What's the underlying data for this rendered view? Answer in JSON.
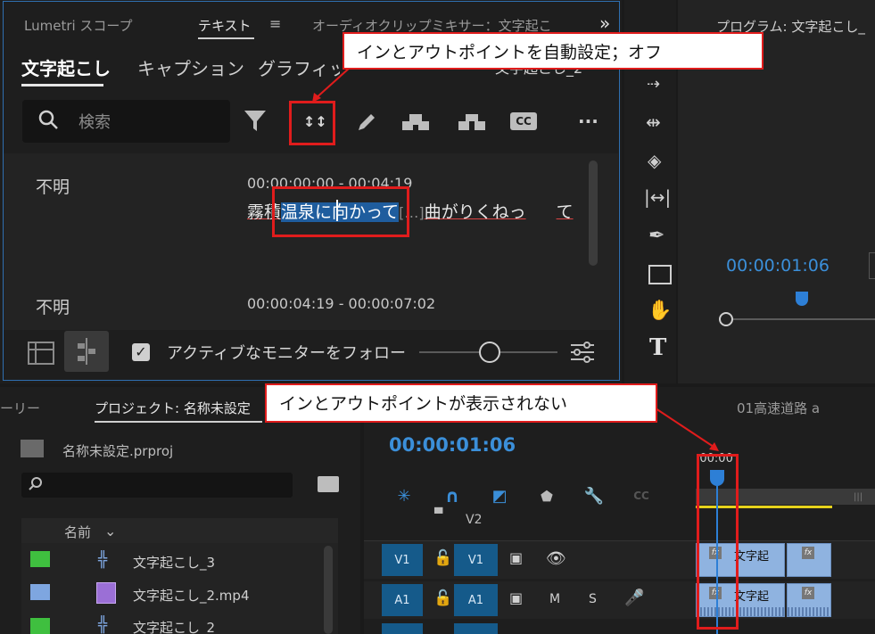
{
  "top_panel": {
    "tabs": [
      "Lumetri スコープ",
      "テキスト",
      "オーディオクリップミキサー：文字起こ"
    ],
    "overflow": "»",
    "subtabs": [
      "文字起こし",
      "キャプション",
      "グラフィック"
    ],
    "subtab_right": "文字起こし_2",
    "search_placeholder": "検索",
    "entries": [
      {
        "speaker": "不明",
        "time": "00:00:00:00 - 00:04:19",
        "text_a": "霧積",
        "text_sel": "温泉に向かって",
        "text_b": "[…]",
        "text_c": "曲がりくねっ",
        "text_d": "て"
      },
      {
        "speaker": "不明",
        "time": "00:00:04:19 - 00:00:07:02"
      }
    ],
    "follow_label": "アクティブなモニターをフォロー"
  },
  "program": {
    "title": "プログラム: 文字起こし_",
    "timecode": "00:00:01:06"
  },
  "project": {
    "tabs": [
      "ーリー",
      "プロジェクト: 名称未設定"
    ],
    "file": "名称未設定.prproj",
    "column": "名前",
    "items": [
      {
        "label": "文字起こし_3",
        "color": "#3fbf3f"
      },
      {
        "label": "文字起こし_2.mp4",
        "color": "#7ea6e0"
      },
      {
        "label": "文字起こし_2",
        "color": "#3fbf3f"
      }
    ]
  },
  "timeline": {
    "sequence_name": "01高速道路 a",
    "timecode": "00:00:01:06",
    "ruler_label": ":00:00",
    "tracks": {
      "v2": "V2",
      "v1_a": "V1",
      "v1_b": "V1",
      "a1_a": "A1",
      "a1_b": "A1",
      "m": "M",
      "s": "S"
    },
    "clip_label": "文字起",
    "fx": "fx"
  },
  "callouts": {
    "top": "インとアウトポイントを自動設定；オフ",
    "bottom": "インとアウトポイントが表示されない"
  }
}
